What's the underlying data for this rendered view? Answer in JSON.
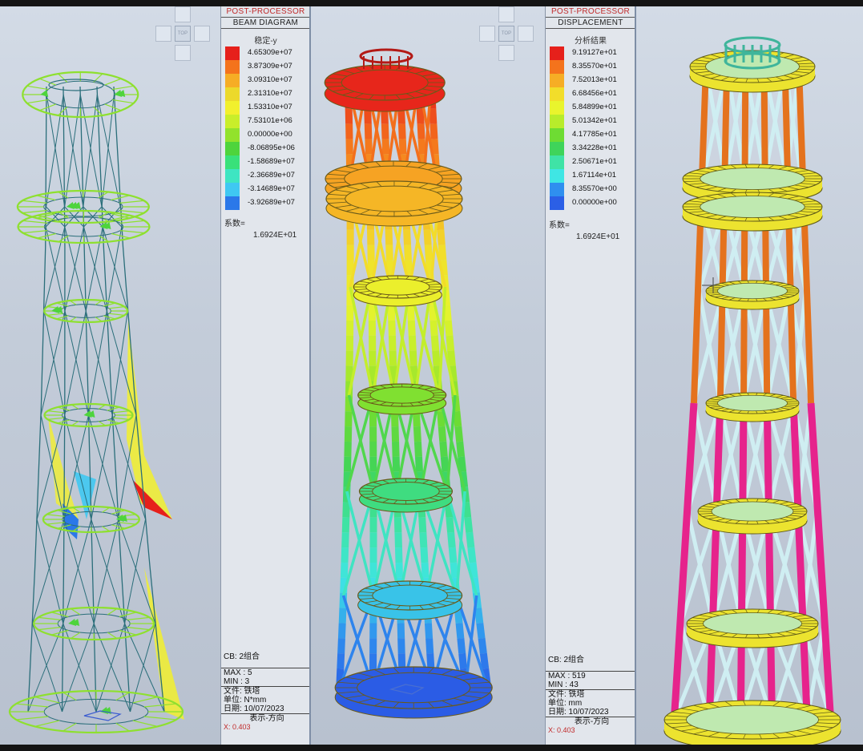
{
  "views": {
    "left": {
      "cube_label": "TOP"
    },
    "middle": {
      "cube_label": "TOP"
    }
  },
  "panel_left": {
    "header1": "POST-PROCESSOR",
    "header2": "BEAM DIAGRAM",
    "subtitle": "稳定-y",
    "legend": [
      {
        "value": "4.65309e+07",
        "color": "#e6201b"
      },
      {
        "value": "3.87309e+07",
        "color": "#f4731c"
      },
      {
        "value": "3.09310e+07",
        "color": "#f6ad25"
      },
      {
        "value": "2.31310e+07",
        "color": "#ecd92b"
      },
      {
        "value": "1.53310e+07",
        "color": "#f2f02d"
      },
      {
        "value": "7.53101e+06",
        "color": "#c9ee2a"
      },
      {
        "value": "0.00000e+00",
        "color": "#92e22c"
      },
      {
        "value": "-8.06895e+06",
        "color": "#4ed43c"
      },
      {
        "value": "-1.58689e+07",
        "color": "#39e17a"
      },
      {
        "value": "-2.36689e+07",
        "color": "#3ee5c2"
      },
      {
        "value": "-3.14689e+07",
        "color": "#3fc8f2"
      },
      {
        "value": "-3.92689e+07",
        "color": "#2b78e9"
      }
    ],
    "factor_label": "系数=",
    "factor_value": "1.6924E+01",
    "cb": "CB: 2组合",
    "max": "MAX : 5",
    "min": "MIN : 3",
    "file": "文件: 铁塔",
    "unit": "单位: N*mm",
    "date": "日期: 10/07/2023",
    "direction": "表示-方向",
    "coord": "X: 0.403"
  },
  "panel_right": {
    "header1": "POST-PROCESSOR",
    "header2": "DISPLACEMENT",
    "subtitle": "分析结果",
    "legend": [
      {
        "value": "9.19127e+01",
        "color": "#e6201b"
      },
      {
        "value": "8.35570e+01",
        "color": "#f4731c"
      },
      {
        "value": "7.52013e+01",
        "color": "#f6ad25"
      },
      {
        "value": "6.68456e+01",
        "color": "#f2dd2a"
      },
      {
        "value": "5.84899e+01",
        "color": "#e9f42d"
      },
      {
        "value": "5.01342e+01",
        "color": "#b8ec2b"
      },
      {
        "value": "4.17785e+01",
        "color": "#6edc33"
      },
      {
        "value": "3.34228e+01",
        "color": "#3fd45a"
      },
      {
        "value": "2.50671e+01",
        "color": "#3fe3a6"
      },
      {
        "value": "1.67114e+01",
        "color": "#3fe6e4"
      },
      {
        "value": "8.35570e+00",
        "color": "#2f8fef"
      },
      {
        "value": "0.00000e+00",
        "color": "#2b5fe6"
      }
    ],
    "factor_label": "系数=",
    "factor_value": "1.6924E+01",
    "cb": "CB: 2组合",
    "max": "MAX : 519",
    "min": "MIN : 43",
    "file": "文件: 铁塔",
    "unit": "单位: mm",
    "date": "日期: 10/07/2023",
    "direction": "表示-方向",
    "coord": "X: 0.403"
  },
  "colors": {
    "ring_yellow": "#ece32f",
    "column_orange": "#e4721d",
    "column_magenta": "#e6238c",
    "brace_cyan": "#cfeef2",
    "ring_teal": "#3fb59b",
    "diagram_green": "#8ee02f",
    "diagram_yellow": "#f2f02d",
    "structure_line": "#2a6e7a"
  }
}
